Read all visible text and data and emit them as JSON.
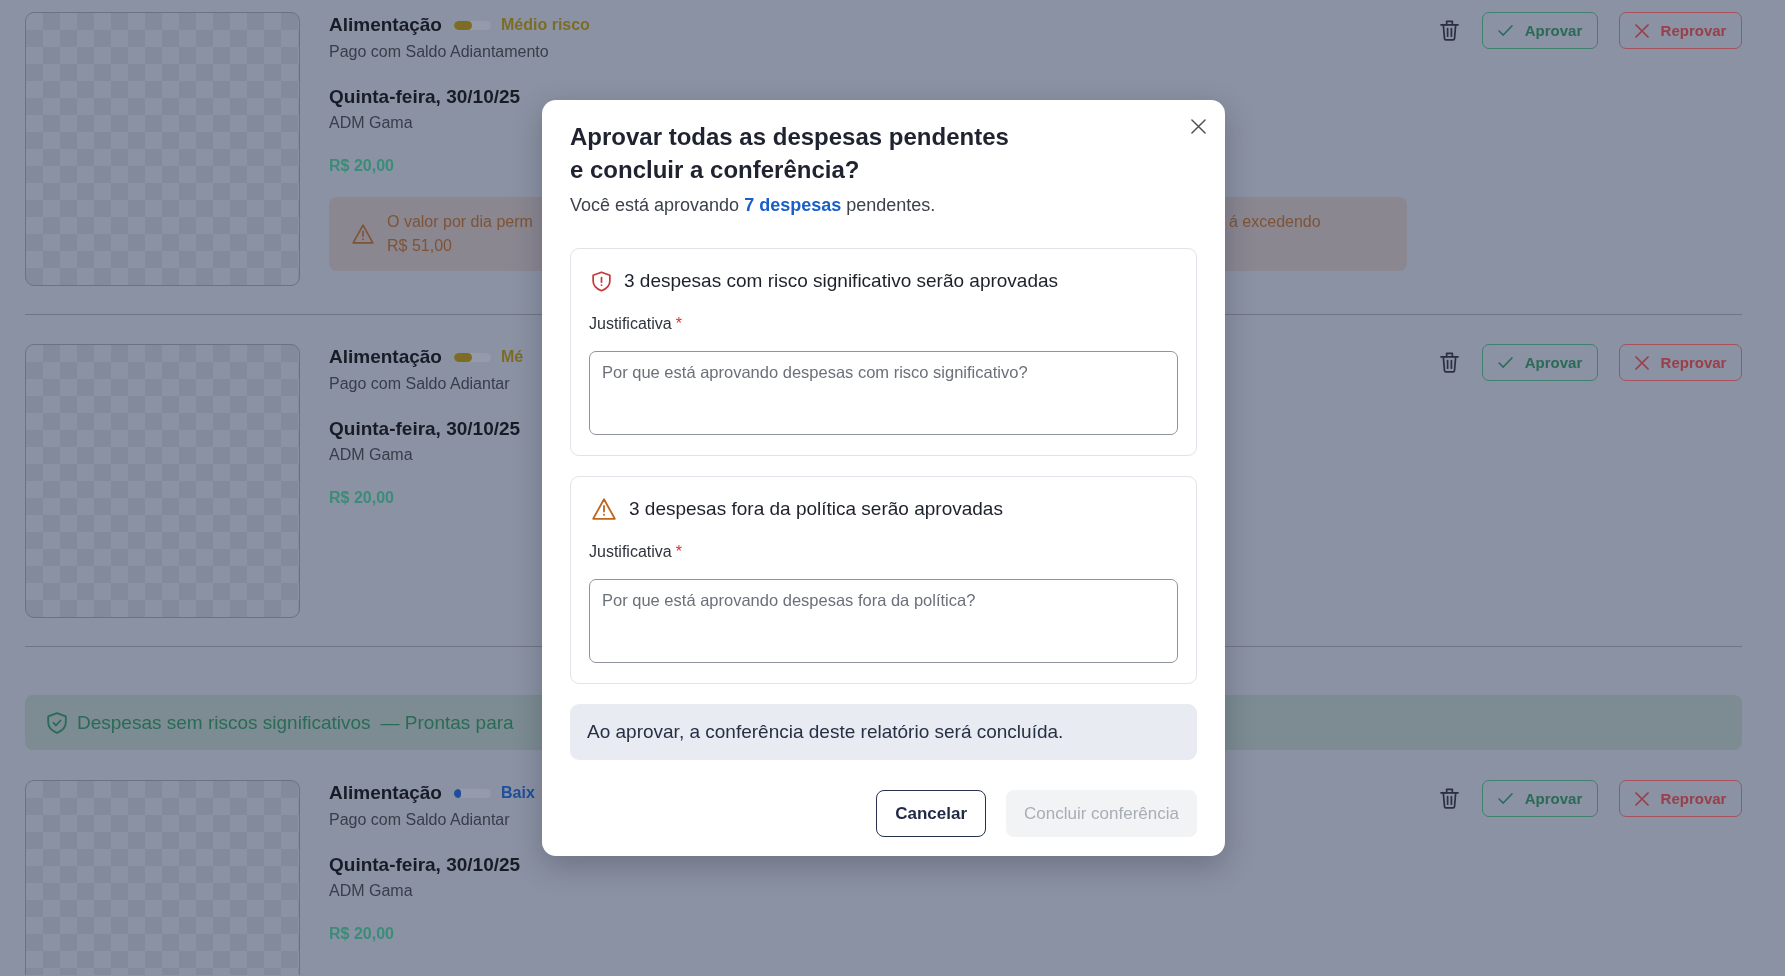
{
  "expense_groups": [
    {
      "expenses": [
        {
          "category": "Alimentação",
          "risk": {
            "level": 0.5,
            "color": "#7d6c24",
            "label": "Médio risco"
          },
          "payment": "Pago com Saldo Adiantamento",
          "date": "Quinta-feira, 30/10/25",
          "submitter": "ADM Gama",
          "amount": "R$ 20,00",
          "alert": {
            "text_start": "O valor por dia perm",
            "amount": "R$ 51,00",
            "text_end": "á excedendo"
          },
          "approve_label": "Aprovar",
          "reject_label": "Reprovar"
        },
        {
          "category": "Alimentação",
          "risk": {
            "level": 0.5,
            "color": "#7d6c24",
            "label": "Mé"
          },
          "payment": "Pago com Saldo Adiantar",
          "date": "Quinta-feira, 30/10/25",
          "submitter": "ADM Gama",
          "amount": "R$ 20,00",
          "approve_label": "Aprovar",
          "reject_label": "Reprovar"
        }
      ]
    },
    {
      "banner": {
        "title": "Despesas sem riscos significativos",
        "subtitle": "— Prontas para"
      },
      "expenses": [
        {
          "category": "Alimentação",
          "risk": {
            "level": 0.2,
            "color": "#1f4e9c",
            "label": "Baix"
          },
          "payment": "Pago com Saldo Adiantar",
          "date": "Quinta-feira, 30/10/25",
          "submitter": "ADM Gama",
          "amount": "R$ 20,00",
          "approve_label": "Aprovar",
          "reject_label": "Reprovar"
        }
      ]
    }
  ],
  "dialog": {
    "title": "Aprovar todas as despesas pendentes e concluir a conferência?",
    "summary": "Você está aprovando **7 despesas** pendentes.",
    "sections": [
      {
        "kind": "risk",
        "heading": "3 despesas com risco significativo serão aprovadas",
        "label": "Justificativa",
        "required_mark": "*",
        "placeholder": "Por que está aprovando despesas com risco significativo?"
      },
      {
        "kind": "policy",
        "heading": "3 despesas fora da política serão aprovadas",
        "label": "Justificativa",
        "required_mark": "*",
        "placeholder": "Por que está aprovando despesas fora da política?"
      }
    ],
    "notice": "Ao aprovar, a conferência deste relatório será concluída.",
    "buttons": [
      {
        "label": "Cancelar",
        "kind": "secondary",
        "disabled": false
      },
      {
        "label": "Concluir conferência",
        "kind": "primary",
        "disabled": true
      }
    ]
  }
}
